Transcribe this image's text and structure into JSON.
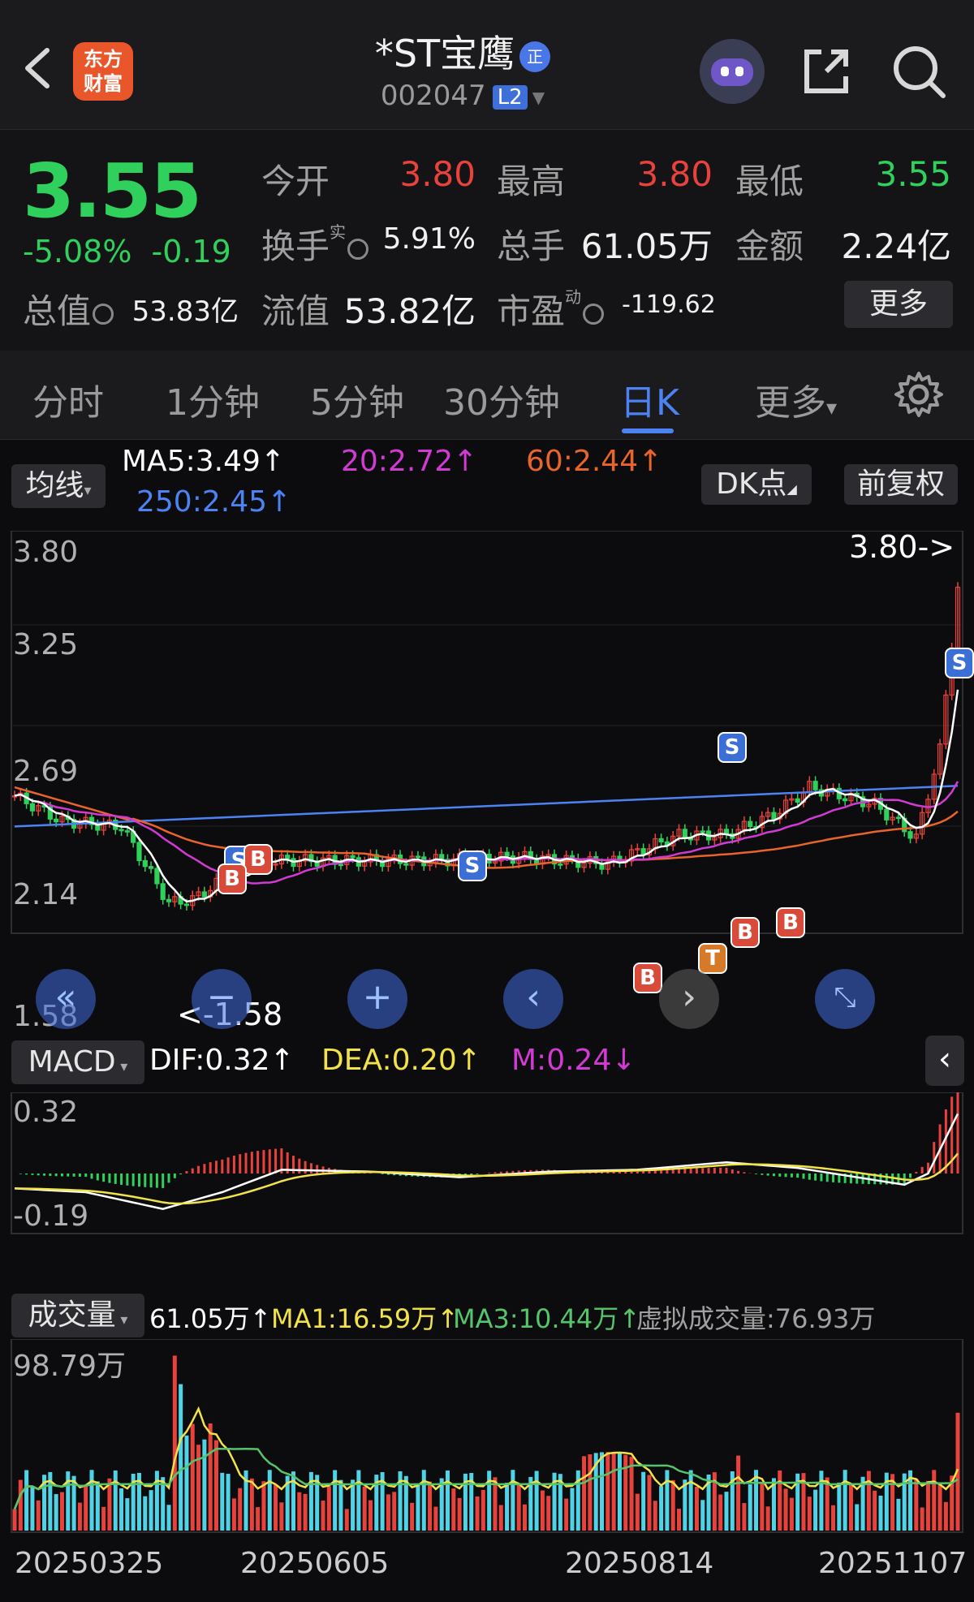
{
  "header": {
    "back_icon": "chevron-left-icon",
    "logo_text_line1": "东方",
    "logo_text_line2": "财富",
    "stock_name": "*ST宝鹰",
    "stock_tag": "正",
    "stock_code": "002047",
    "level_badge": "L2",
    "icons": [
      "robot-assistant-icon",
      "share-icon",
      "search-icon"
    ]
  },
  "quote": {
    "price": "3.55",
    "change_pct": "-5.08%",
    "change_abs": "-0.19",
    "open_label": "今开",
    "open_value": "3.80",
    "high_label": "最高",
    "high_value": "3.80",
    "low_label": "最低",
    "low_value": "3.55",
    "turnover_label": "换手",
    "turnover_sup": "实",
    "turnover_value": "5.91%",
    "volume_label": "总手",
    "volume_value": "61.05万",
    "amount_label": "金额",
    "amount_value": "2.24亿",
    "mktcap_label": "总值",
    "mktcap_value": "53.83亿",
    "float_label": "流值",
    "float_value": "53.82亿",
    "pe_label": "市盈",
    "pe_sup": "动",
    "pe_value": "-119.62",
    "more_label": "更多",
    "colors": {
      "up": "#e8423c",
      "down": "#2fd05b"
    }
  },
  "tabs": {
    "items": [
      "分时",
      "1分钟",
      "5分钟",
      "30分钟",
      "日K",
      "更多"
    ],
    "active": "日K",
    "more_caret": "▾"
  },
  "kline": {
    "ma_selector": "均线",
    "ma5": "MA5:3.49↑",
    "ma20": "20:2.72↑",
    "ma60": "60:2.44↑",
    "ma250": "250:2.45↑",
    "dk_label": "DK点",
    "adjust_label": "前复权",
    "price_axis": [
      "3.80",
      "3.25",
      "2.69",
      "2.14",
      "1.58"
    ],
    "max_label": "3.80->",
    "min_label": "<-1.58",
    "markers": [
      "S",
      "B",
      "B",
      "S",
      "S",
      "B",
      "T",
      "B",
      "B",
      "S"
    ],
    "colors": {
      "ma5": "#ffffff",
      "ma20": "#d23ad4",
      "ma60": "#e8642a",
      "ma250": "#4d82f3"
    }
  },
  "nav": {
    "icons": [
      "rewind-icon",
      "zoom-out-icon",
      "zoom-in-icon",
      "prev-icon",
      "next-icon",
      "fullscreen-icon"
    ]
  },
  "macd": {
    "selector": "MACD",
    "dif": "DIF:0.32↑",
    "dea": "DEA:0.20↑",
    "m": "M:0.24↓",
    "axis": [
      "0.32",
      "-0.19"
    ],
    "colors": {
      "dif": "#ffffff",
      "dea": "#f2e24a",
      "m": "#d23ad4"
    }
  },
  "volume": {
    "selector": "成交量",
    "value": "61.05万↑",
    "ma1": "MA1:16.59万↑",
    "ma3": "MA3:10.44万↑",
    "virtual": "虚拟成交量:76.93万",
    "axis_max": "98.79万",
    "dates": [
      "20250325",
      "20250605",
      "20250814",
      "20251107"
    ]
  }
}
